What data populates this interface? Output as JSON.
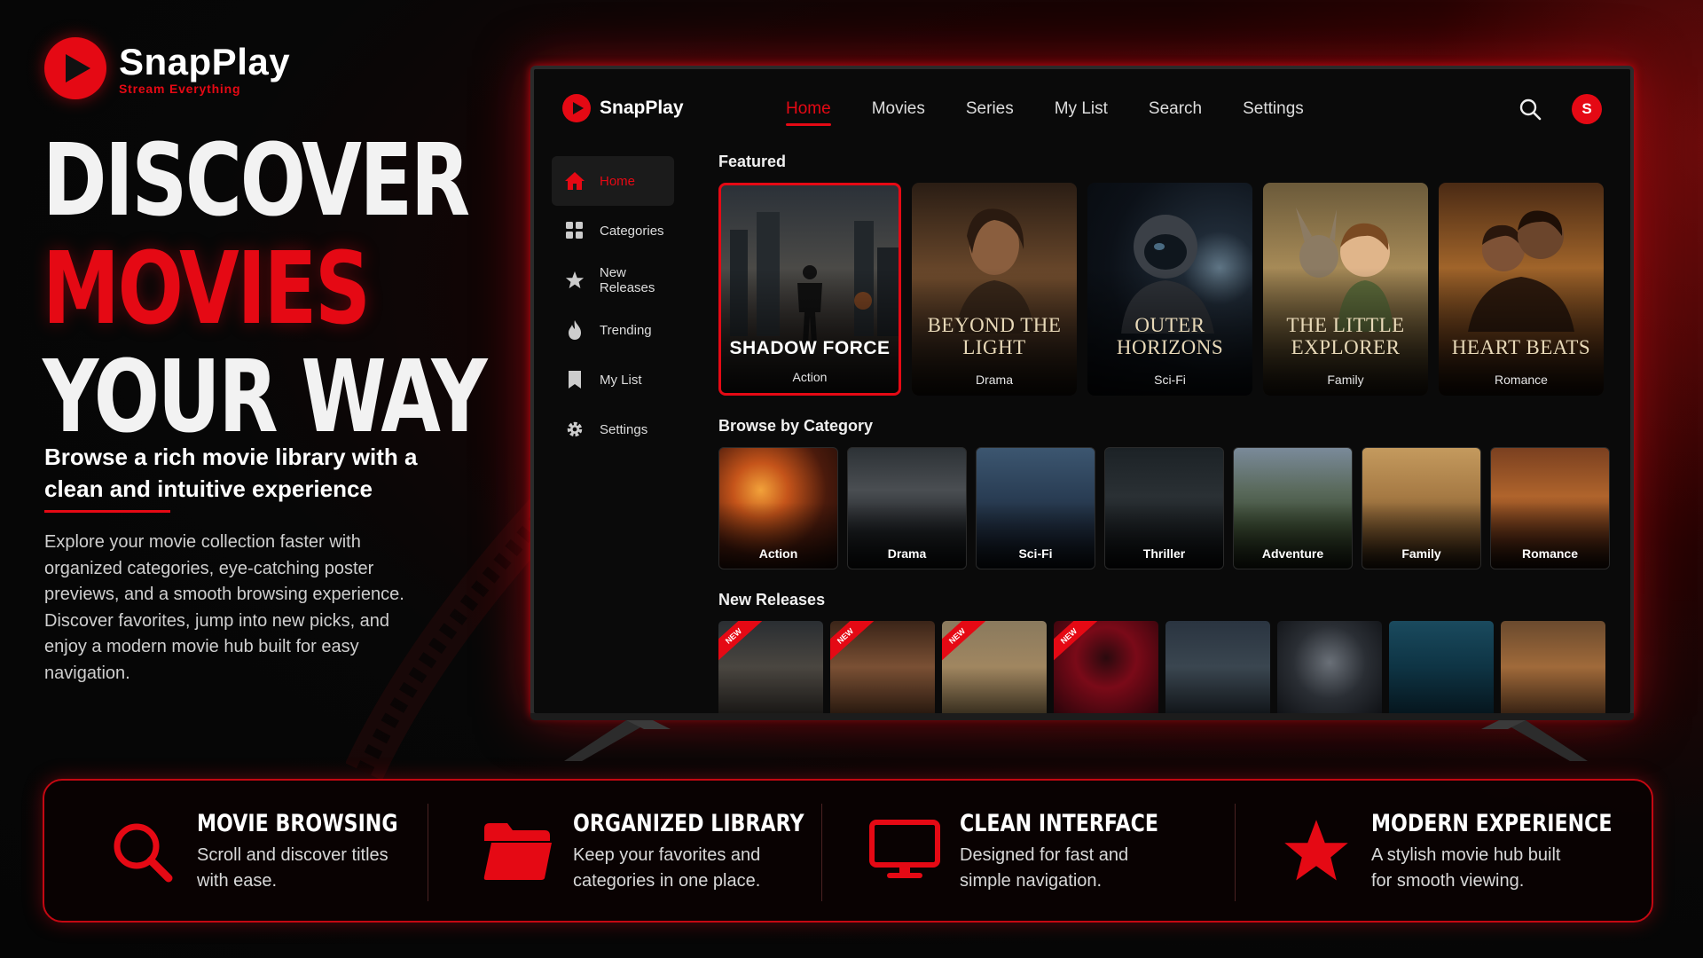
{
  "brand": {
    "name": "SnapPlay",
    "tagline": "Stream Everything"
  },
  "hero": {
    "line1": "DISCOVER",
    "line2": "MOVIES",
    "line3": "YOUR WAY",
    "subtitle": "Browse a rich movie library with a clean and intuitive experience",
    "description": "Explore your movie collection faster with organized categories, eye-catching poster previews, and a smooth browsing experience. Discover favorites, jump into new picks, and enjoy a modern movie hub built for easy navigation."
  },
  "app": {
    "logo": "SnapPlay",
    "nav": [
      "Home",
      "Movies",
      "Series",
      "My List",
      "Search",
      "Settings"
    ],
    "active_nav": "Home",
    "avatar_initial": "S",
    "sidebar": [
      {
        "label": "Home",
        "icon": "home-icon"
      },
      {
        "label": "Categories",
        "icon": "grid-icon"
      },
      {
        "label": "New Releases",
        "icon": "star-icon"
      },
      {
        "label": "Trending",
        "icon": "flame-icon"
      },
      {
        "label": "My List",
        "icon": "bookmark-icon"
      },
      {
        "label": "Settings",
        "icon": "gear-icon"
      }
    ],
    "featured_title": "Featured",
    "featured": [
      {
        "title": "SHADOW FORCE",
        "genre": "Action"
      },
      {
        "title": "BEYOND THE LIGHT",
        "genre": "Drama"
      },
      {
        "title": "OUTER HORIZONS",
        "genre": "Sci-Fi"
      },
      {
        "title": "THE LITTLE EXPLORER",
        "genre": "Family"
      },
      {
        "title": "HEART BEATS",
        "genre": "Romance"
      }
    ],
    "browse_title": "Browse by Category",
    "categories": [
      "Action",
      "Drama",
      "Sci-Fi",
      "Thriller",
      "Adventure",
      "Family",
      "Romance"
    ],
    "new_releases_title": "New Releases",
    "new_badge": "NEW"
  },
  "features": [
    {
      "title": "MOVIE BROWSING",
      "desc": "Scroll and discover titles with ease.",
      "icon": "search-icon"
    },
    {
      "title": "ORGANIZED LIBRARY",
      "desc": "Keep your favorites and categories in one place.",
      "icon": "folder-icon"
    },
    {
      "title": "CLEAN INTERFACE",
      "desc": "Designed for fast and simple navigation.",
      "icon": "monitor-icon"
    },
    {
      "title": "MODERN EXPERIENCE",
      "desc": "A stylish movie hub built for smooth viewing.",
      "icon": "star-icon"
    }
  ],
  "colors": {
    "accent": "#e50914",
    "background": "#070707"
  }
}
